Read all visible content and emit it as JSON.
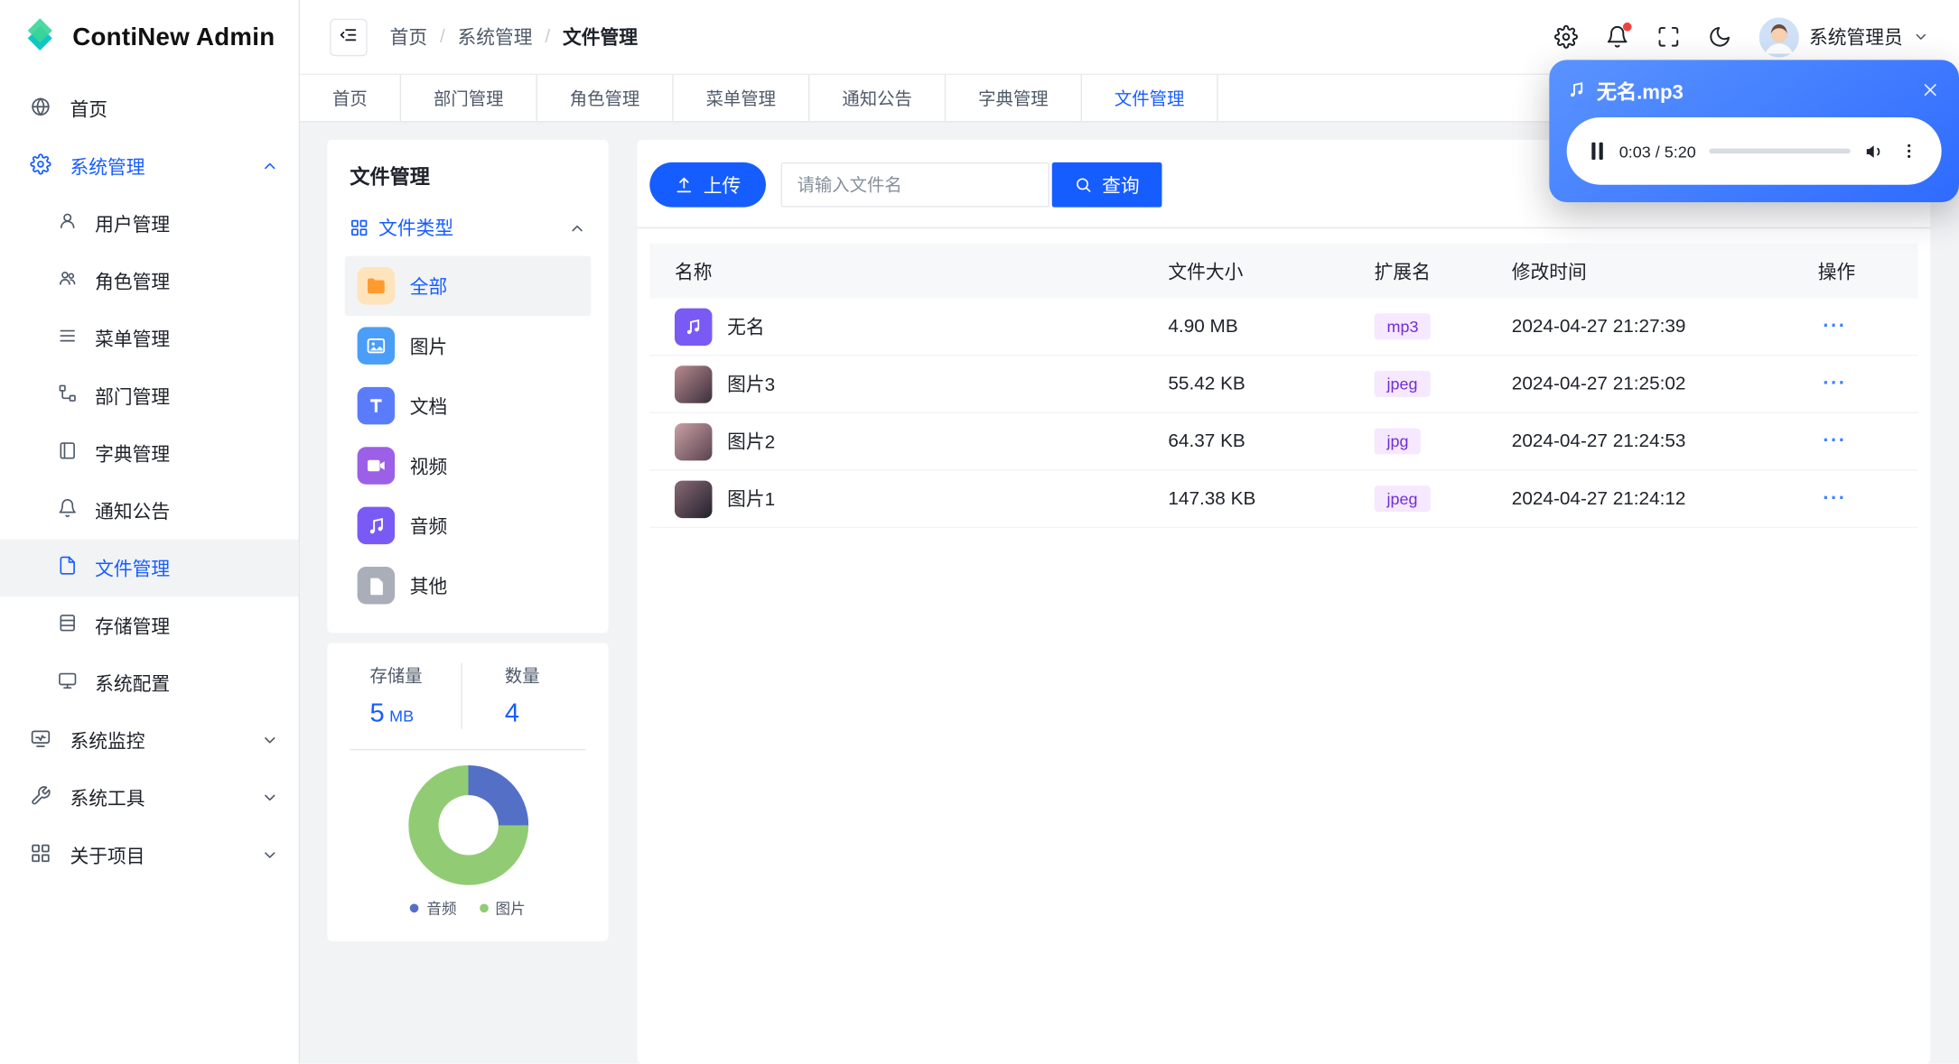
{
  "app": {
    "logo_text": "ContiNew Admin"
  },
  "header": {
    "breadcrumb": [
      "首页",
      "系统管理",
      "文件管理"
    ],
    "breadcrumb_separator": "/",
    "user_name": "系统管理员"
  },
  "tabs": {
    "items": [
      {
        "label": "首页"
      },
      {
        "label": "部门管理"
      },
      {
        "label": "角色管理"
      },
      {
        "label": "菜单管理"
      },
      {
        "label": "通知公告"
      },
      {
        "label": "字典管理"
      },
      {
        "label": "文件管理",
        "active": true
      }
    ]
  },
  "sidebar": {
    "items": [
      {
        "label": "首页"
      },
      {
        "label": "系统管理",
        "expanded": true,
        "children": [
          "用户管理",
          "角色管理",
          "菜单管理",
          "部门管理",
          "字典管理",
          "通知公告",
          "文件管理",
          "存储管理",
          "系统配置"
        ],
        "selected_child": "文件管理"
      },
      {
        "label": "系统监控"
      },
      {
        "label": "系统工具"
      },
      {
        "label": "关于项目"
      }
    ]
  },
  "files": {
    "panel_title": "文件管理",
    "group_label": "文件类型",
    "types": [
      {
        "label": "全部",
        "active": true
      },
      {
        "label": "图片"
      },
      {
        "label": "文档"
      },
      {
        "label": "视频"
      },
      {
        "label": "音频"
      },
      {
        "label": "其他"
      }
    ],
    "stats": {
      "storage_label": "存储量",
      "storage_value": "5",
      "storage_unit": "MB",
      "count_label": "数量",
      "count_value": "4"
    }
  },
  "toolbar": {
    "upload_label": "上传",
    "search_placeholder": "请输入文件名",
    "query_label": "查询"
  },
  "table": {
    "headers": [
      "名称",
      "文件大小",
      "扩展名",
      "修改时间",
      "操作"
    ],
    "more_label": "···",
    "rows": [
      {
        "name": "无名",
        "size": "4.90 MB",
        "ext": "mp3",
        "time": "2024-04-27 21:27:39",
        "kind": "audio"
      },
      {
        "name": "图片3",
        "size": "55.42 KB",
        "ext": "jpeg",
        "time": "2024-04-27 21:25:02",
        "kind": "image"
      },
      {
        "name": "图片2",
        "size": "64.37 KB",
        "ext": "jpg",
        "time": "2024-04-27 21:24:53",
        "kind": "image"
      },
      {
        "name": "图片1",
        "size": "147.38 KB",
        "ext": "jpeg",
        "time": "2024-04-27 21:24:12",
        "kind": "image"
      }
    ]
  },
  "player": {
    "title": "无名.mp3",
    "time": "0:03 / 5:20"
  },
  "chart_data": {
    "type": "pie",
    "donut": true,
    "labels": [
      "音频",
      "图片"
    ],
    "values": [
      1,
      3
    ],
    "colors": [
      "#5470c6",
      "#91cc75"
    ],
    "legend_position": "bottom"
  },
  "colors": {
    "primary": "#165dff",
    "badge_bg": "#f5e8ff",
    "badge_text": "#722ed1",
    "notification_dot": "#f53f3f"
  }
}
